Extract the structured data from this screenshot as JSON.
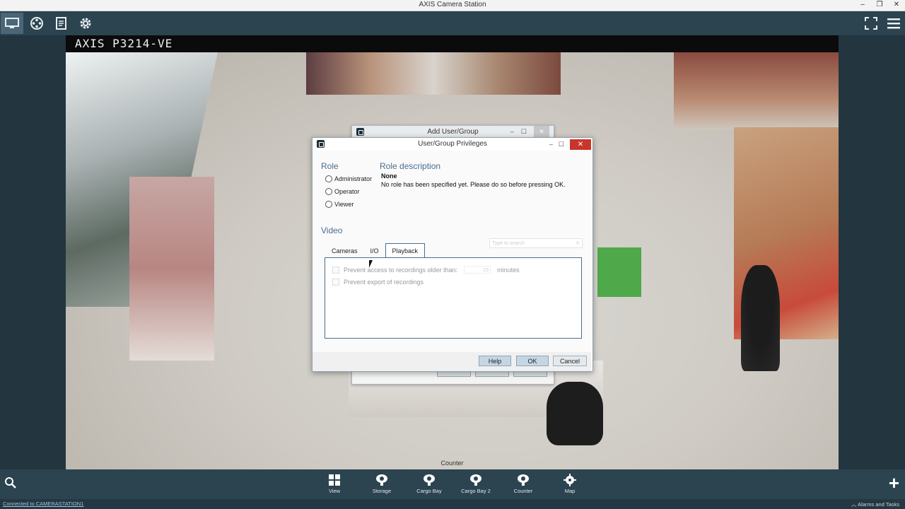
{
  "window": {
    "title": "AXIS Camera Station"
  },
  "camera": {
    "name": "AXIS P3214-VE",
    "view_label": "Counter"
  },
  "add_user_dialog": {
    "title": "Add User/Group"
  },
  "privileges_dialog": {
    "title": "User/Group Privileges",
    "role": {
      "heading": "Role",
      "options": [
        "Administrator",
        "Operator",
        "Viewer"
      ]
    },
    "role_description": {
      "heading": "Role description",
      "title": "None",
      "text": "No role has been specified yet. Please do so before pressing OK."
    },
    "video": {
      "heading": "Video",
      "search_placeholder": "Type to search",
      "tabs": [
        "Cameras",
        "I/O",
        "Playback"
      ],
      "active_tab": "Playback",
      "playback": {
        "prevent_access_label": "Prevent access to recordings older than:",
        "minutes_value": "15",
        "minutes_label": "minutes",
        "prevent_export_label": "Prevent export of recordings"
      }
    },
    "buttons": {
      "help": "Help",
      "ok": "OK",
      "cancel": "Cancel"
    }
  },
  "bottom_nav": [
    "View",
    "Storage",
    "Cargo Bay",
    "Cargo Bay 2",
    "Counter",
    "Map"
  ],
  "status": {
    "left": "Connected to CAMERASTATION1",
    "right": "Alarms and Tasks"
  }
}
